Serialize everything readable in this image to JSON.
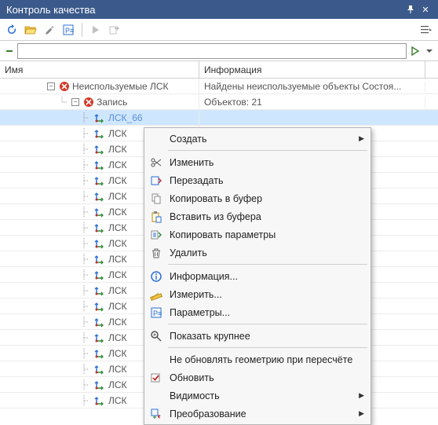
{
  "titlebar": {
    "title": "Контроль качества"
  },
  "columns": {
    "name": "Имя",
    "info": "Информация"
  },
  "tree": {
    "root": {
      "label": "Неиспользуемые ЛСК",
      "info": "Найдены неиспользуемые объекты Состоя..."
    },
    "record": {
      "label": "Запись",
      "info": "Объектов: 21"
    },
    "selected": {
      "label": "ЛСК_66"
    },
    "children": [
      "ЛСК",
      "ЛСК",
      "ЛСК",
      "ЛСК",
      "ЛСК",
      "ЛСК",
      "ЛСК",
      "ЛСК",
      "ЛСК",
      "ЛСК",
      "ЛСК",
      "ЛСК",
      "ЛСК",
      "ЛСК",
      "ЛСК",
      "ЛСК",
      "ЛСК",
      "ЛСК"
    ]
  },
  "search": {
    "placeholder": ""
  },
  "context_menu": [
    {
      "id": "create",
      "label": "Создать",
      "icon": null,
      "submenu": true
    },
    {
      "sep": true
    },
    {
      "id": "edit",
      "label": "Изменить",
      "icon": "scissors"
    },
    {
      "id": "reassign",
      "label": "Перезадать",
      "icon": "reassign"
    },
    {
      "id": "copy",
      "label": "Копировать в буфер",
      "icon": "copy"
    },
    {
      "id": "paste",
      "label": "Вставить из буфера",
      "icon": "paste"
    },
    {
      "id": "copy-params",
      "label": "Копировать параметры",
      "icon": "copy-params"
    },
    {
      "id": "delete",
      "label": "Удалить",
      "icon": "trash"
    },
    {
      "sep": true
    },
    {
      "id": "info",
      "label": "Информация...",
      "icon": "info"
    },
    {
      "id": "measure",
      "label": "Измерить...",
      "icon": "measure"
    },
    {
      "id": "params",
      "label": "Параметры...",
      "icon": "params"
    },
    {
      "sep": true
    },
    {
      "id": "zoom",
      "label": "Показать крупнее",
      "icon": "zoom"
    },
    {
      "sep": true
    },
    {
      "id": "no-update",
      "label": "Не обновлять геометрию при пересчёте",
      "icon": null
    },
    {
      "id": "refresh",
      "label": "Обновить",
      "icon": "checkbox"
    },
    {
      "id": "visibility",
      "label": "Видимость",
      "icon": null,
      "submenu": true
    },
    {
      "id": "transform",
      "label": "Преобразование",
      "icon": "transform",
      "submenu": true
    }
  ]
}
